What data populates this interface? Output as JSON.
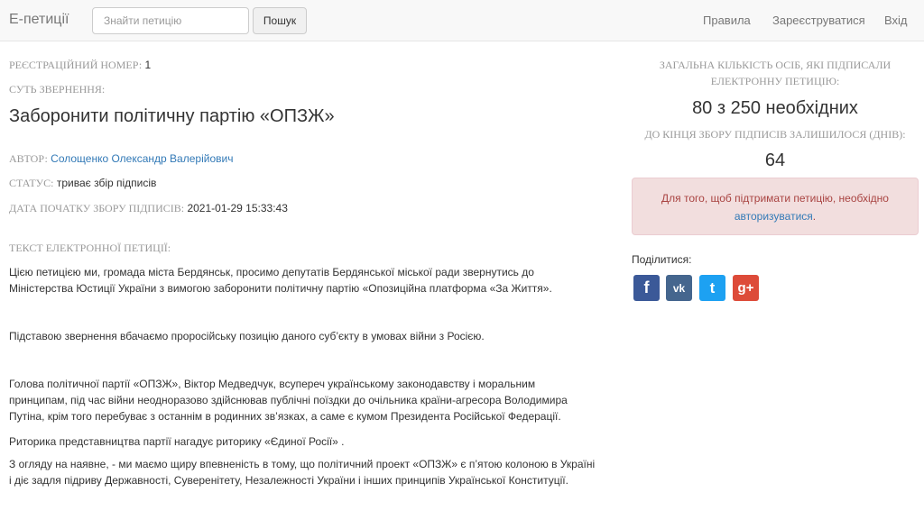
{
  "navbar": {
    "brand": "Е-петиції",
    "search_placeholder": "Знайти петицію",
    "search_button": "Пошук",
    "links": [
      "Правила",
      "Зареєструватися",
      "Вхід"
    ]
  },
  "petition": {
    "reg_label": "РЕЄСТРАЦІЙНИЙ НОМЕР:",
    "reg_value": "1",
    "essence_label": "СУТЬ ЗВЕРНЕННЯ:",
    "title": "Заборонити політичну партію «ОПЗЖ»",
    "author_label": "АВТОР:",
    "author": "Солощенко Олександр Валерійович",
    "status_label": "СТАТУС:",
    "status": "триває збір підписів",
    "date_label": "ДАТА ПОЧАТКУ ЗБОРУ ПІДПИСІВ:",
    "date": "2021-01-29 15:33:43",
    "text_label": "ТЕКСТ ЕЛЕКТРОННОЇ ПЕТИЦІЇ:",
    "paragraphs": [
      "Цією петицією ми, громада міста Бердянськ, просимо депутатів Бердянської міської ради звернутись до Міністерства Юстиції України з вимогою заборонити політичну партію «Опозиційна платформа «За Життя».",
      "Підставою звернення вбачаємо проросійську позицію даного суб’єкту в умовах війни з Росією.",
      "Голова політичної партії «ОПЗЖ», Віктор Медведчук, всупереч українському законодавству і моральним принципам, під час війни неодноразово здійснював публічні поїздки до очільника країни-агресора Володимира Путіна, крім того перебуває з останнім в родинних зв’язках, а саме є кумом Президента Російської Федерації.",
      "Риторика представництва партії нагадує риторику «Єдиної Росії» .",
      "З огляду на наявне, - ми маємо щиру впевненість в тому, що політичний проект «ОПЗЖ» є п’ятою колоною в Україні і діє задля підриву Державності, Суверенітету, Незалежності України і інших принципів Української Конституції."
    ]
  },
  "sidebar": {
    "signed_label": "ЗАГАЛЬНА КІЛЬКІСТЬ ОСІБ, ЯКІ ПІДПИСАЛИ ЕЛЕКТРОННУ ПЕТИЦІЮ:",
    "signed_count": "80 з 250 необхідних",
    "days_label": "ДО КІНЦЯ ЗБОРУ ПІДПИСІВ ЗАЛИШИЛОСЯ (ДНІВ):",
    "days": "64",
    "alert_text": "Для того, щоб підтримати петицію, необхідно",
    "alert_link": "авторизуватися",
    "share_label": "Поділитися:",
    "social": [
      {
        "icon": "facebook-icon",
        "glyph": "f",
        "color": "#3b5998"
      },
      {
        "icon": "vk-icon",
        "glyph": "vk",
        "color": "#45668e"
      },
      {
        "icon": "twitter-icon",
        "glyph": "t",
        "color": "#1da1f2"
      },
      {
        "icon": "google-plus-icon",
        "glyph": "g+",
        "color": "#dd4b39"
      }
    ]
  }
}
